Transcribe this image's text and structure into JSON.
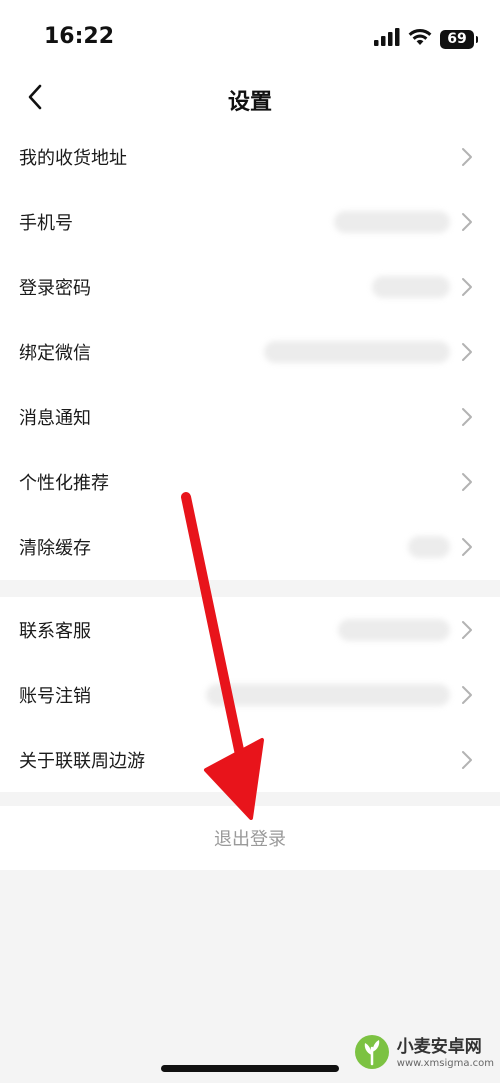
{
  "status_bar": {
    "time": "16:22",
    "battery": "69",
    "icons": [
      "signal-icon",
      "wifi-icon",
      "battery-icon"
    ]
  },
  "nav": {
    "title": "设置",
    "back_icon": "chevron-left-icon"
  },
  "settings": {
    "group1": [
      {
        "label": "我的收货地址"
      },
      {
        "label": "手机号"
      },
      {
        "label": "登录密码"
      },
      {
        "label": "绑定微信"
      },
      {
        "label": "消息通知"
      },
      {
        "label": "个性化推荐"
      },
      {
        "label": "清除缓存"
      }
    ],
    "group2": [
      {
        "label": "联系客服"
      },
      {
        "label": "账号注销"
      },
      {
        "label": "关于联联周边游"
      }
    ]
  },
  "logout": {
    "label": "退出登录"
  },
  "annotation": {
    "color": "#e8141b"
  },
  "watermark": {
    "title": "小麦安卓网",
    "url": "www.xmsigma.com"
  },
  "colors": {
    "background": "#f4f4f4",
    "surface": "#ffffff",
    "text": "#1a1a1a",
    "muted": "#9a9a9a",
    "chevron": "#b3b3b3"
  }
}
